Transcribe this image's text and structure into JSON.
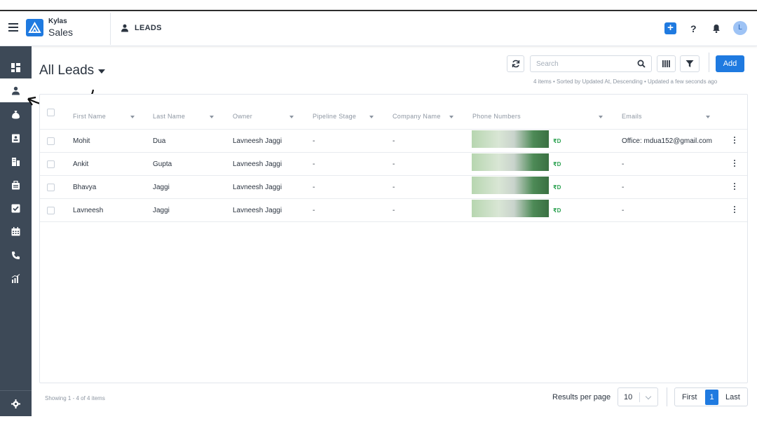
{
  "header": {
    "brand_top": "Kylas",
    "brand_main": "Sales",
    "module_title": "LEADS",
    "plus_label": "+",
    "help_label": "?",
    "avatar_initial": "L"
  },
  "sidebar": {
    "items": [
      {
        "icon": "dashboard-icon",
        "active": false
      },
      {
        "icon": "user-icon",
        "active": true
      },
      {
        "icon": "money-bag-icon",
        "active": false
      },
      {
        "icon": "contact-card-icon",
        "active": false
      },
      {
        "icon": "building-icon",
        "active": false
      },
      {
        "icon": "briefcase-icon",
        "active": false
      },
      {
        "icon": "checkbox-icon",
        "active": false
      },
      {
        "icon": "calendar-icon",
        "active": false
      },
      {
        "icon": "phone-icon",
        "active": false
      },
      {
        "icon": "reports-icon",
        "active": false
      }
    ],
    "bottom_icon": "gear-icon"
  },
  "page": {
    "title": "All Leads",
    "search_placeholder": "Search",
    "add_label": "Add",
    "meta": "4 items • Sorted by Updated At, Descending • Updated a few seconds ago"
  },
  "table": {
    "columns": [
      "First Name",
      "Last Name",
      "Owner",
      "Pipeline Stage",
      "Company Name",
      "Phone Numbers",
      "Emails"
    ],
    "rows": [
      {
        "first": "Mohit",
        "last": "Dua",
        "owner": "Lavneesh Jaggi",
        "stage": "-",
        "company": "-",
        "phone_tag": "₹D",
        "email": "Office: mdua152@gmail.com"
      },
      {
        "first": "Ankit",
        "last": "Gupta",
        "owner": "Lavneesh Jaggi",
        "stage": "-",
        "company": "-",
        "phone_tag": "₹D",
        "email": "-"
      },
      {
        "first": "Bhavya",
        "last": "Jaggi",
        "owner": "Lavneesh Jaggi",
        "stage": "-",
        "company": "-",
        "phone_tag": "₹D",
        "email": "-"
      },
      {
        "first": "Lavneesh",
        "last": "Jaggi",
        "owner": "Lavneesh Jaggi",
        "stage": "-",
        "company": "-",
        "phone_tag": "₹D",
        "email": "-"
      }
    ]
  },
  "footer": {
    "showing": "Showing 1 - 4 of 4 items",
    "rpp_label": "Results per page",
    "rpp_value": "10",
    "first": "First",
    "current_page": "1",
    "last": "Last"
  },
  "colors": {
    "accent": "#1f7ae0",
    "sidebar": "#3d4957",
    "phone_tag": "#2aa14f"
  }
}
